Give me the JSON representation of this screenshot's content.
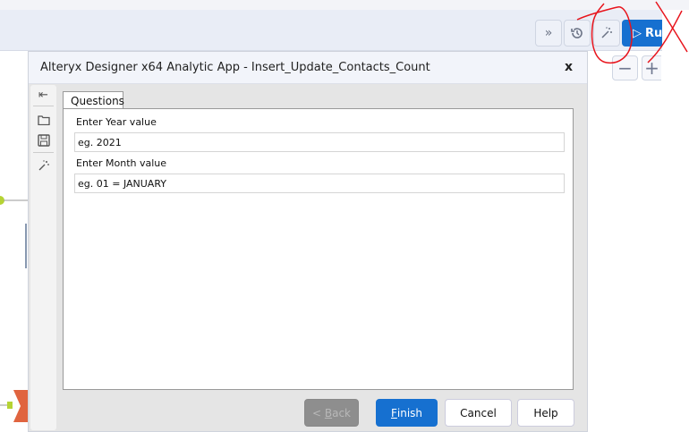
{
  "toolbar": {
    "expand_icon": "double-chevron-right",
    "history_icon": "history",
    "wand_icon": "magic-wand",
    "run_label": "Ru",
    "zoom_out": "−",
    "zoom_in": "+"
  },
  "dialog": {
    "title": "Alteryx Designer  x64 Analytic App  - Insert_Update_Contacts_Count",
    "close": "x",
    "tab": "Questions",
    "fields": [
      {
        "label": "Enter Year value",
        "value": "eg. 2021"
      },
      {
        "label": "Enter Month value",
        "value": "eg. 01 = JANUARY"
      }
    ],
    "buttons": {
      "back_prefix": "< ",
      "back_key": "B",
      "back_rest": "ack",
      "finish_key": "F",
      "finish_rest": "inish",
      "cancel": "Cancel",
      "help": "Help"
    }
  },
  "colors": {
    "accent": "#1670d0",
    "annotation": "#e8141c"
  }
}
